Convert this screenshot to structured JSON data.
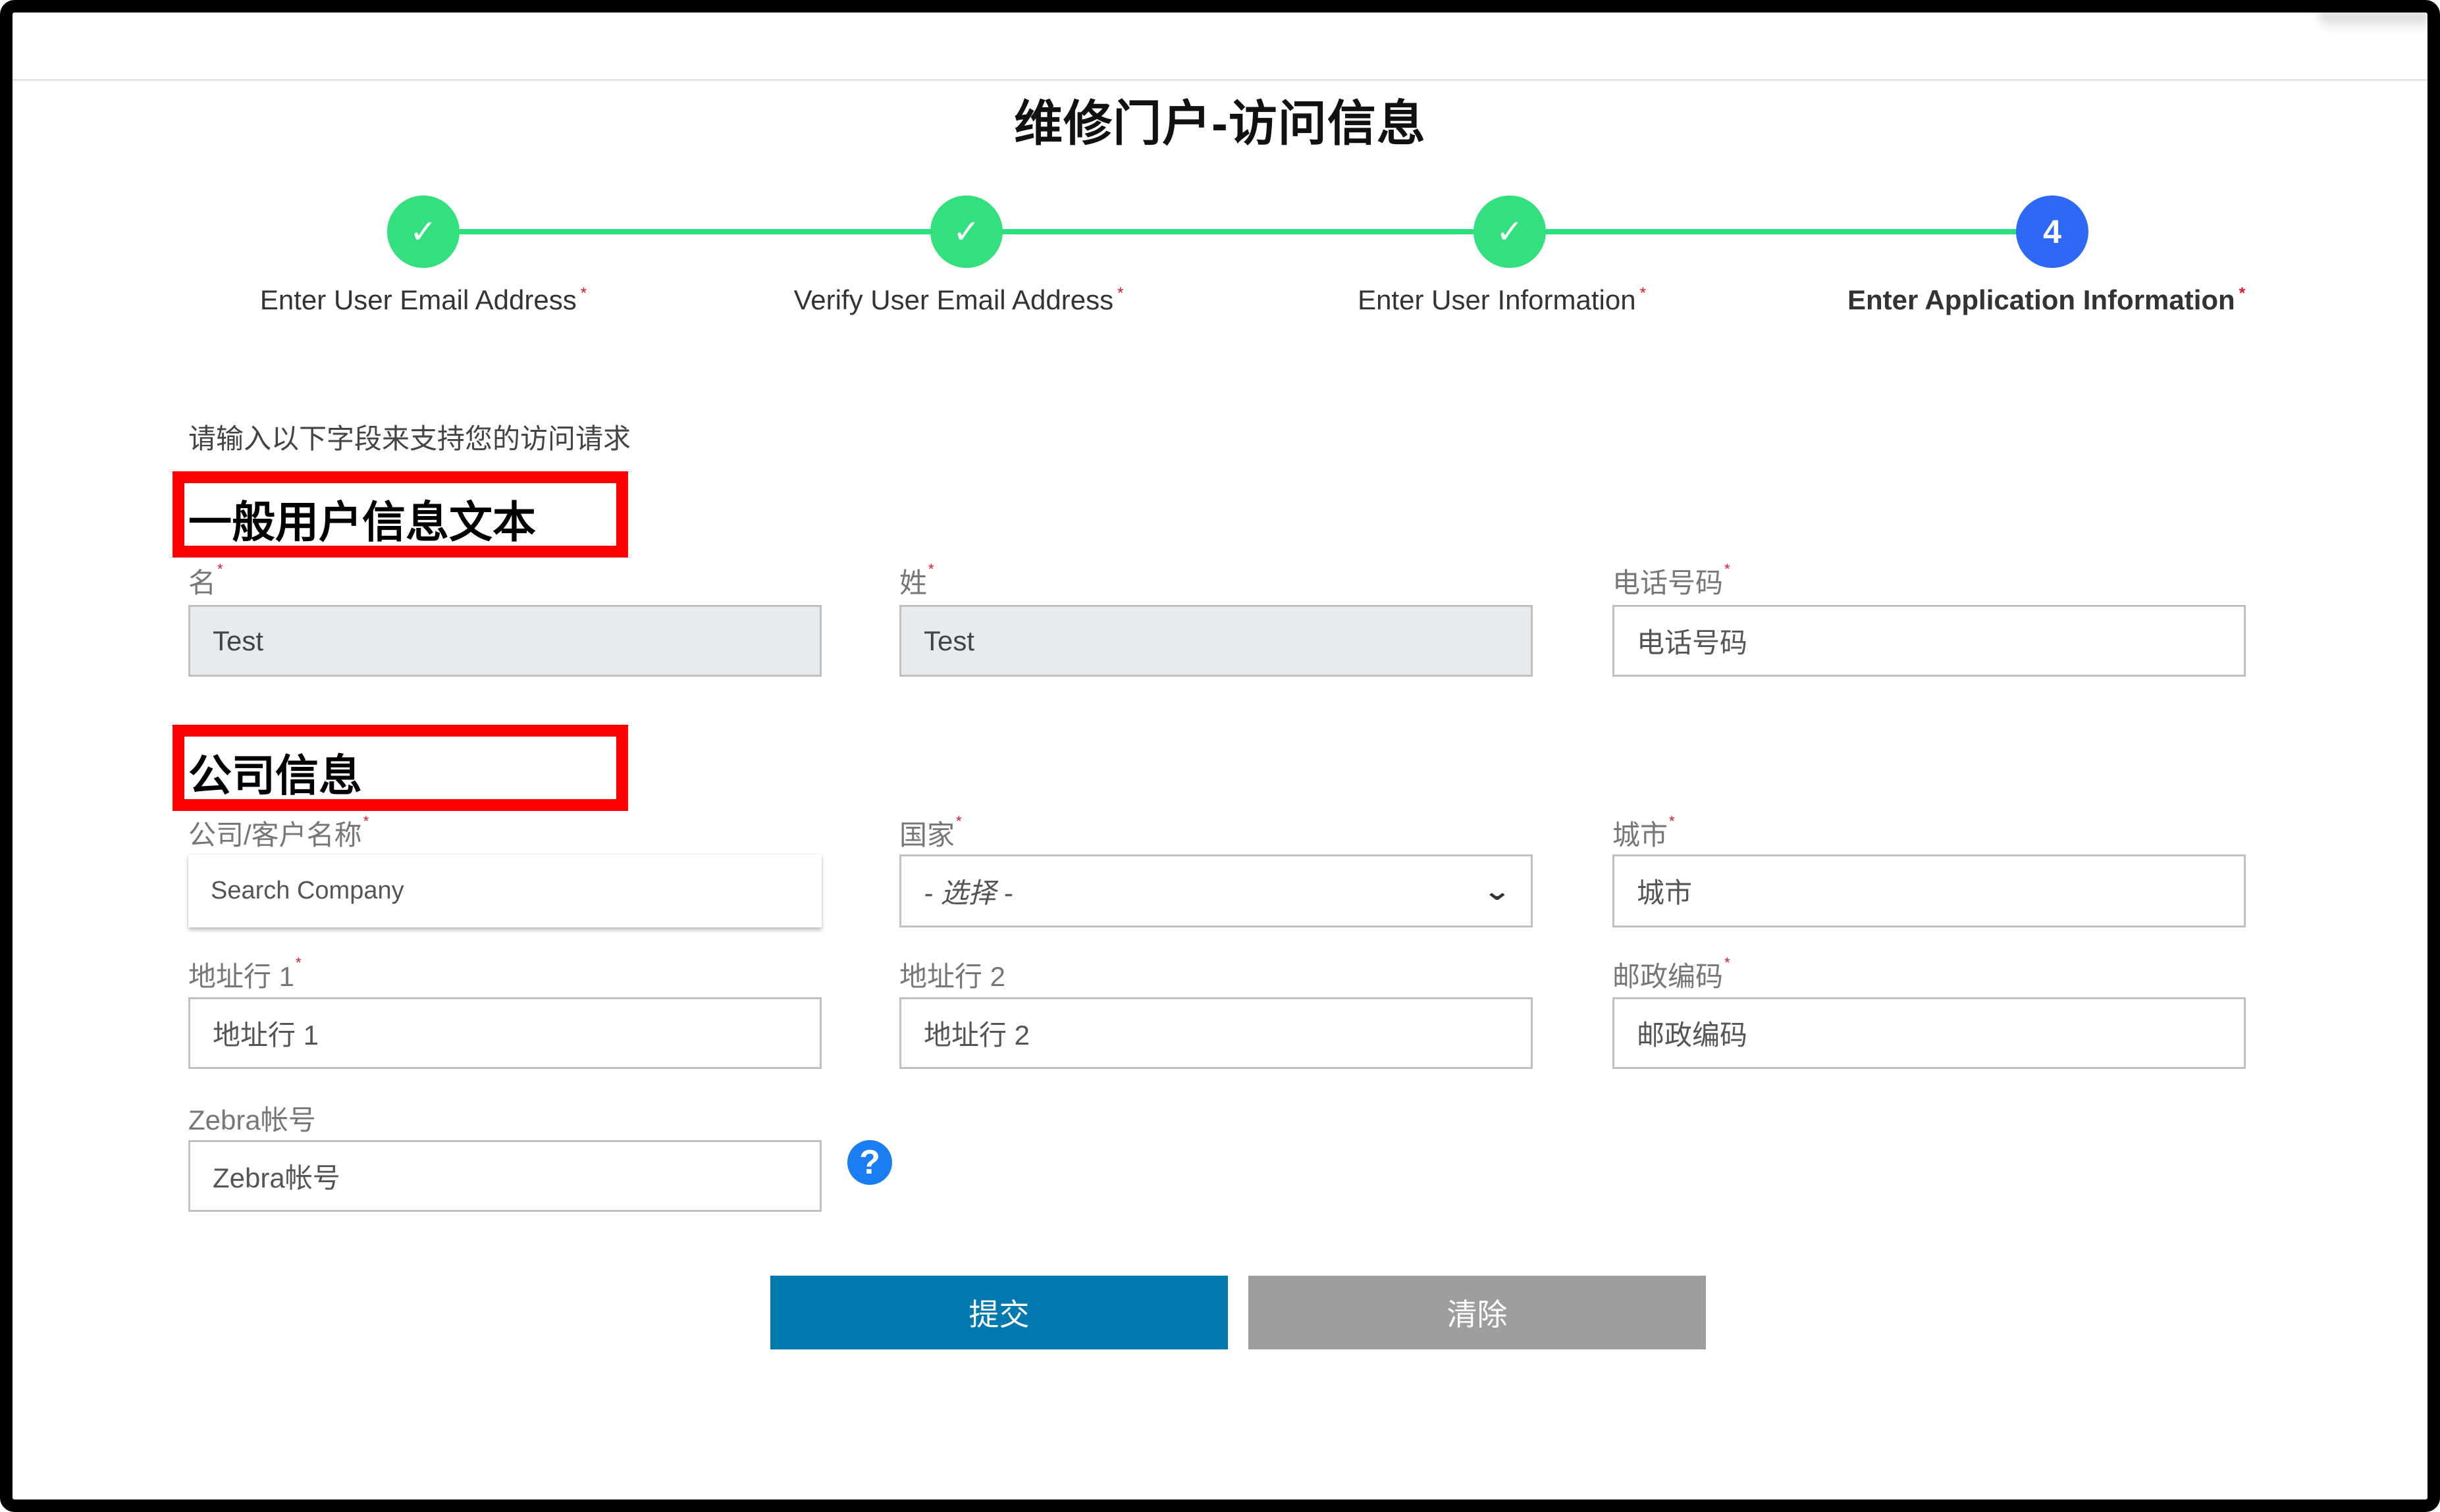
{
  "page": {
    "title": "维修门户-访问信息",
    "intro": "请输入以下字段来支持您的访问请求"
  },
  "stepper": {
    "steps": [
      {
        "label": "Enter User Email Address",
        "status": "completed",
        "marker": "✓"
      },
      {
        "label": "Verify User Email Address",
        "status": "completed",
        "marker": "✓"
      },
      {
        "label": "Enter User Information",
        "status": "completed",
        "marker": "✓"
      },
      {
        "label": "Enter Application Information",
        "status": "current",
        "marker": "4"
      }
    ],
    "required_mark": "*"
  },
  "sections": {
    "general": {
      "title": "一般用户信息文本",
      "fields": {
        "first_name": {
          "label": "名",
          "required": true,
          "value": "Test",
          "disabled": true
        },
        "last_name": {
          "label": "姓",
          "required": true,
          "value": "Test",
          "disabled": true
        },
        "phone": {
          "label": "电话号码",
          "required": true,
          "placeholder": "电话号码"
        }
      }
    },
    "company": {
      "title": "公司信息",
      "fields": {
        "company_name": {
          "label": "公司/客户名称",
          "required": true,
          "placeholder": "Search Company"
        },
        "country": {
          "label": "国家",
          "required": true,
          "selected": "- 选择 -"
        },
        "city": {
          "label": "城市",
          "required": true,
          "placeholder": "城市"
        },
        "address1": {
          "label": "地址行 1",
          "required": true,
          "placeholder": "地址行 1"
        },
        "address2": {
          "label": "地址行 2",
          "required": false,
          "placeholder": "地址行 2"
        },
        "postal_code": {
          "label": "邮政编码",
          "required": true,
          "placeholder": "邮政编码"
        },
        "zebra_account": {
          "label": "Zebra帐号",
          "required": false,
          "placeholder": "Zebra帐号"
        }
      }
    }
  },
  "buttons": {
    "submit": "提交",
    "clear": "清除"
  },
  "icons": {
    "check": "✓",
    "chevron_down": "⌄",
    "help": "?"
  },
  "colors": {
    "step_done": "#32e07d",
    "step_current": "#2d68f7",
    "submit": "#0079ae",
    "clear": "#9e9e9e",
    "annotation": "#ff0000",
    "required": "#e0142a"
  }
}
